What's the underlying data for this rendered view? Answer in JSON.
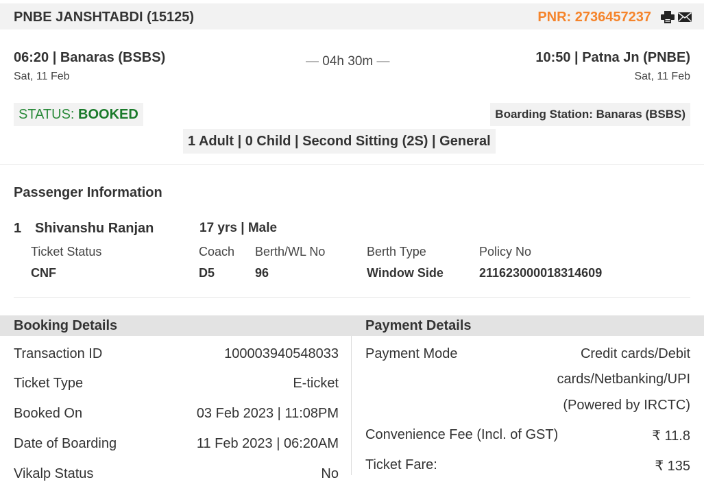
{
  "header": {
    "train_name": "PNBE JANSHTABDI (15125)",
    "pnr": "PNR: 2736457237",
    "accent_color": "#f5842b"
  },
  "journey": {
    "departure": "06:20 | Banaras (BSBS)",
    "departure_date": "Sat, 11 Feb",
    "duration": "04h 30m",
    "arrival": "10:50 | Patna Jn (PNBE)",
    "arrival_date": "Sat, 11 Feb"
  },
  "status": {
    "label": "STATUS:",
    "value": "BOOKED",
    "boarding": "Boarding Station: Banaras (BSBS)",
    "class_summary": "1 Adult | 0 Child | Second Sitting (2S) | General"
  },
  "passenger_section": {
    "title": "Passenger Information",
    "passengers": [
      {
        "number": "1",
        "name": "Shivanshu Ranjan",
        "info": "17 yrs | Male",
        "labels": [
          "Ticket Status",
          "Coach",
          "Berth/WL No",
          "Berth Type",
          "Policy No"
        ],
        "values": [
          "CNF",
          "D5",
          "96",
          "Window Side",
          "211623000018314609"
        ]
      }
    ]
  },
  "booking_details": {
    "title": "Booking Details",
    "rows": [
      {
        "label": "Transaction ID",
        "value": "100003940548033"
      },
      {
        "label": "Ticket Type",
        "value": "E-ticket"
      },
      {
        "label": "Booked On",
        "value": "03 Feb 2023 | 11:08PM"
      },
      {
        "label": "Date of Boarding",
        "value": "11 Feb 2023 | 06:20AM"
      },
      {
        "label": "Vikalp Status",
        "value": "No"
      }
    ]
  },
  "payment_details": {
    "title": "Payment Details",
    "mode_label": "Payment Mode",
    "mode_lines": [
      "Credit cards/Debit",
      "cards/Netbanking/UPI",
      "(Powered by IRCTC)"
    ],
    "rows": [
      {
        "label": "Convenience Fee (Incl. of GST)",
        "value": "₹ 11.8"
      },
      {
        "label": "Ticket Fare:",
        "value": "₹ 135"
      }
    ]
  }
}
